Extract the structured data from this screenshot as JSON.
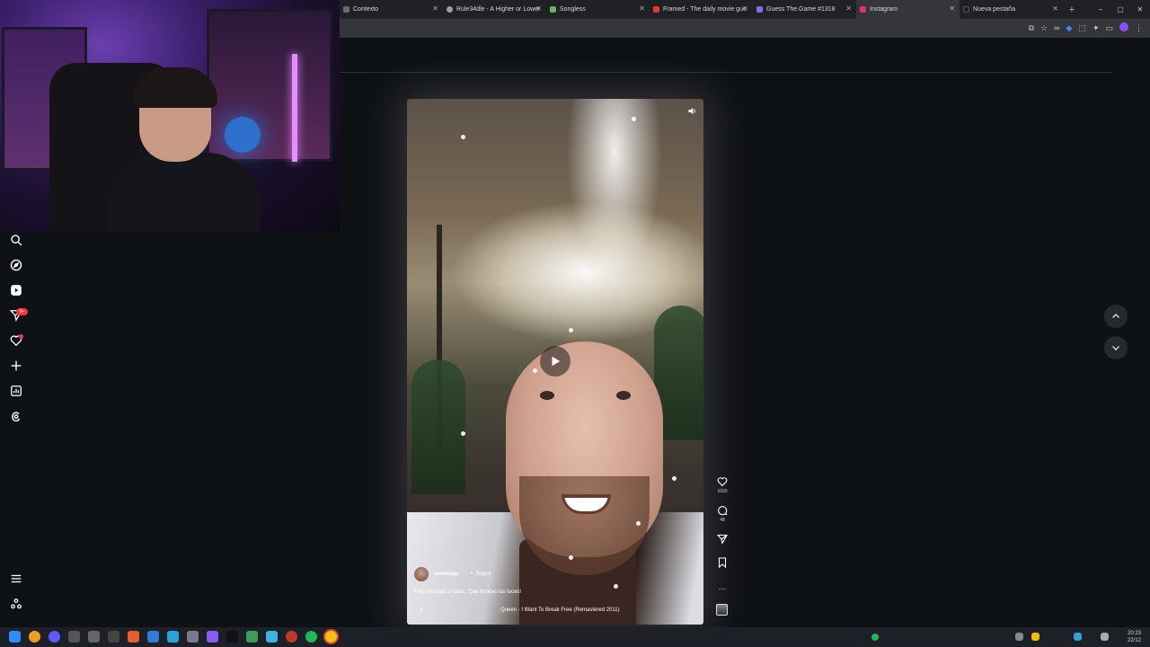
{
  "browser": {
    "tabs": [
      {
        "title": "Contexto",
        "favicon_color": "#6d6d6d"
      },
      {
        "title": "Rule34dle - A Higher or Lower",
        "favicon_color": "#9aa0a6"
      },
      {
        "title": "Songless",
        "favicon_color": "#5cb85c"
      },
      {
        "title": "Framed - The daily movie gue",
        "favicon_color": "#e53935"
      },
      {
        "title": "Guess The.Game #1318",
        "favicon_color": "#7c6cff"
      },
      {
        "title": "Instagram",
        "favicon_color": "#e1306c",
        "active": true
      },
      {
        "title": "Nueva pestaña",
        "favicon_color": "#202124"
      }
    ],
    "new_tab_label": "+",
    "window_controls": {
      "minimize": "–",
      "maximize": "▢",
      "close": "✕"
    }
  },
  "sidebar": {
    "items": [
      {
        "name": "search",
        "icon": "search-icon"
      },
      {
        "name": "explore",
        "icon": "compass-icon"
      },
      {
        "name": "reels",
        "icon": "reels-icon"
      },
      {
        "name": "messages",
        "icon": "direct-icon",
        "badge": "9+"
      },
      {
        "name": "notifications",
        "icon": "heart-icon"
      },
      {
        "name": "create",
        "icon": "plus-icon"
      },
      {
        "name": "dashboard",
        "icon": "dashboard-icon"
      },
      {
        "name": "threads",
        "icon": "threads-icon"
      },
      {
        "name": "more",
        "icon": "menu-icon"
      },
      {
        "name": "meta",
        "icon": "meta-icon"
      }
    ]
  },
  "reel": {
    "username": "sasebaga",
    "separator": "•",
    "follow_label": "Seguir",
    "caption": "Feliz navidad a todos. Que bonitas las luces!",
    "audio": "Queen - I Want To Break Free (Remastered 2011)",
    "likes": "1020",
    "comments": "48"
  },
  "taskbar": {
    "time": "20:23",
    "date": "22/12"
  }
}
